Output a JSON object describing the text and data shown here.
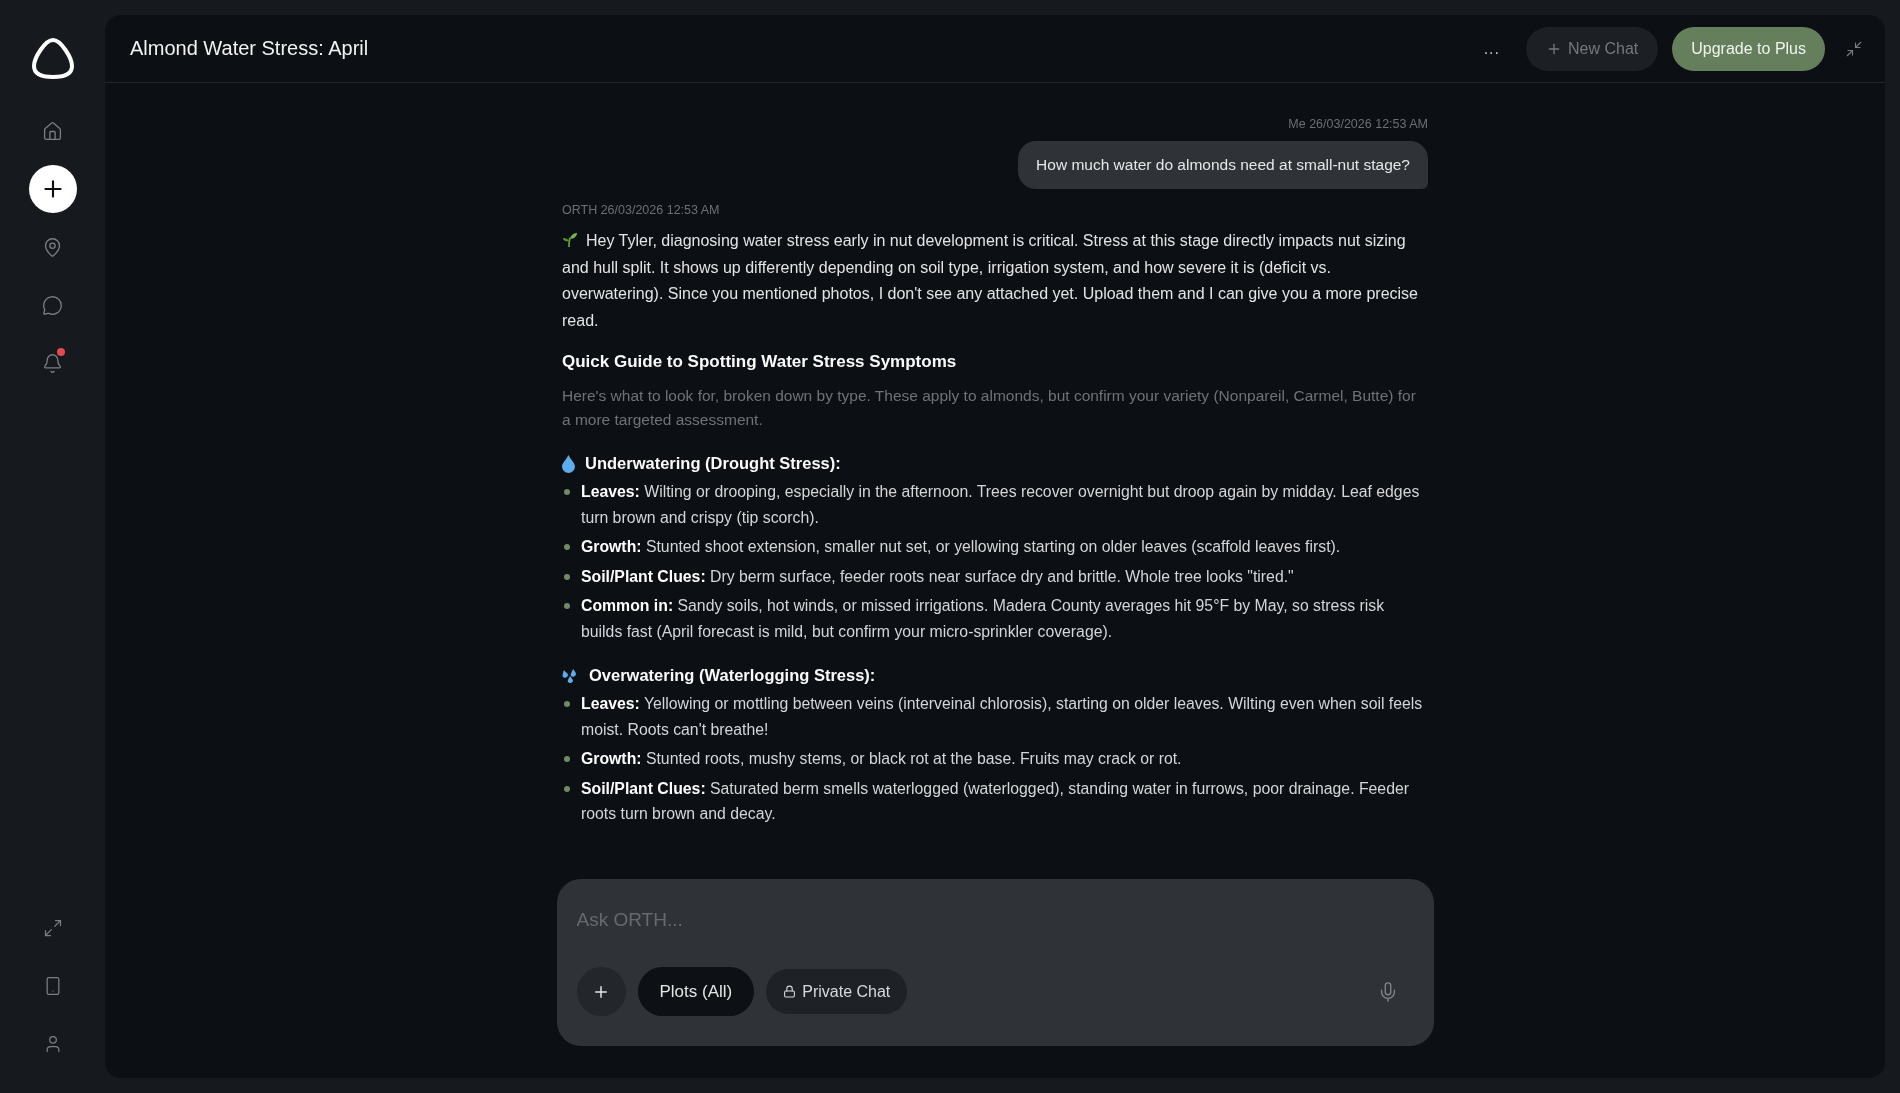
{
  "sidebar": {
    "items": [
      {
        "kind": "home"
      },
      {
        "kind": "new"
      },
      {
        "kind": "location"
      },
      {
        "kind": "chat"
      },
      {
        "kind": "bell",
        "badge": true
      }
    ],
    "bottom_items": [
      {
        "kind": "expand"
      },
      {
        "kind": "phone"
      },
      {
        "kind": "user"
      }
    ]
  },
  "header": {
    "title": "Almond Water Stress: April",
    "more": "...",
    "new_chat": "New Chat",
    "upgrade": "Upgrade to Plus"
  },
  "messages": [
    {
      "kind": "user",
      "meta": "Me 26/03/2026 12:53 AM",
      "text": "How much water do almonds need at small-nut stage?"
    },
    {
      "kind": "assistant",
      "meta": "ORTH 26/03/2026 12:53 AM",
      "intro": "Hey Tyler, diagnosing water stress early in nut development is critical. Stress at this stage directly impacts nut sizing and hull split. It shows up differently depending on soil type, irrigation system, and how severe it is (deficit vs. overwatering). Since you mentioned photos, I don't see any attached yet. Upload them and I can give you a more precise read.",
      "heading": "Quick Guide to Spotting Water Stress Symptoms",
      "subtext": "Here's what to look for, broken down by type. These apply to almonds, but confirm your variety (Nonpareil, Carmel, Butte) for a more targeted assessment.",
      "sections": [
        {
          "kind": "drop",
          "title": "Underwatering (Drought Stress):",
          "bullets": [
            "**Leaves:** Wilting or drooping, especially in the afternoon. Trees recover overnight but droop again by midday. Leaf edges turn brown and crispy (tip scorch).",
            "**Growth:** Stunted shoot extension, smaller nut set, or yellowing starting on older leaves (scaffold leaves first).",
            "**Soil/Plant Clues:** Dry berm surface, feeder roots near surface dry and brittle. Whole tree looks \"tired.\"",
            "**Common in:** Sandy soils, hot winds, or missed irrigations. Madera County averages hit 95°F by May, so stress risk builds fast (April forecast is mild, but confirm your micro-sprinkler coverage)."
          ]
        },
        {
          "kind": "splash",
          "title": "Overwatering (Waterlogging Stress):",
          "bullets": [
            "**Leaves:** Yellowing or mottling between veins (interveinal chlorosis), starting on older leaves. Wilting even when soil feels moist. Roots can't breathe!",
            "**Growth:** Stunted roots, mushy stems, or black rot at the base. Fruits may crack or rot.",
            "**Soil/Plant Clues:** Saturated berm smells waterlogged (waterlogged), standing water in furrows, poor drainage. Feeder roots turn brown and decay."
          ]
        }
      ]
    }
  ],
  "composer": {
    "placeholder": "Ask ORTH...",
    "plots": "Plots (All)",
    "private": "Private Chat"
  }
}
